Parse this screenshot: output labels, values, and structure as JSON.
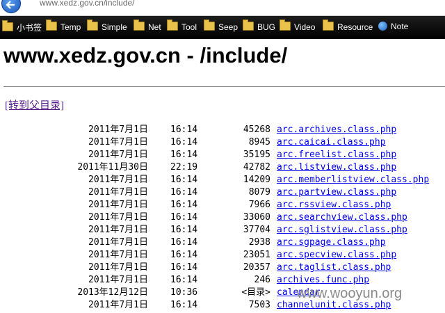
{
  "browser": {
    "url": "www.xedz.gov.cn/include/",
    "bookmarks": [
      {
        "label": "小书签",
        "icon": "folder-icon"
      },
      {
        "label": "Temp",
        "icon": "folder-icon"
      },
      {
        "label": "Simple",
        "icon": "folder-icon"
      },
      {
        "label": "Net",
        "icon": "folder-icon"
      },
      {
        "label": "Tool",
        "icon": "folder-icon"
      },
      {
        "label": "Seep",
        "icon": "folder-icon"
      },
      {
        "label": "BUG",
        "icon": "folder-icon"
      },
      {
        "label": "Video",
        "icon": "folder-icon"
      },
      {
        "label": "Resource",
        "icon": "folder-icon"
      },
      {
        "label": "Note",
        "icon": "globe-icon"
      }
    ]
  },
  "page": {
    "title": "www.xedz.gov.cn - /include/",
    "parent_link": "[转到父目录]"
  },
  "files": [
    {
      "date": "2011年7月1日",
      "time": "16:14",
      "size": "45268",
      "name": "arc.archives.class.php"
    },
    {
      "date": "2011年7月1日",
      "time": "16:14",
      "size": "8945",
      "name": "arc.caicai.class.php"
    },
    {
      "date": "2011年7月1日",
      "time": "16:14",
      "size": "35195",
      "name": "arc.freelist.class.php"
    },
    {
      "date": "2011年11月30日",
      "time": "22:19",
      "size": "42782",
      "name": "arc.listview.class.php"
    },
    {
      "date": "2011年7月1日",
      "time": "16:14",
      "size": "14209",
      "name": "arc.memberlistview.class.php"
    },
    {
      "date": "2011年7月1日",
      "time": "16:14",
      "size": "8079",
      "name": "arc.partview.class.php"
    },
    {
      "date": "2011年7月1日",
      "time": "16:14",
      "size": "7966",
      "name": "arc.rssview.class.php"
    },
    {
      "date": "2011年7月1日",
      "time": "16:14",
      "size": "33060",
      "name": "arc.searchview.class.php"
    },
    {
      "date": "2011年7月1日",
      "time": "16:14",
      "size": "37704",
      "name": "arc.sglistview.class.php"
    },
    {
      "date": "2011年7月1日",
      "time": "16:14",
      "size": "2938",
      "name": "arc.sgpage.class.php"
    },
    {
      "date": "2011年7月1日",
      "time": "16:14",
      "size": "23051",
      "name": "arc.specview.class.php"
    },
    {
      "date": "2011年7月1日",
      "time": "16:14",
      "size": "20357",
      "name": "arc.taglist.class.php"
    },
    {
      "date": "2011年7月1日",
      "time": "16:14",
      "size": "246",
      "name": "archives.func.php"
    },
    {
      "date": "2013年12月12日",
      "time": "10:36",
      "size": "<目录>",
      "name": "calendar"
    },
    {
      "date": "2011年7月1日",
      "time": "16:14",
      "size": "7503",
      "name": "channelunit.class.php"
    }
  ],
  "watermark": "www.wooyun.org"
}
